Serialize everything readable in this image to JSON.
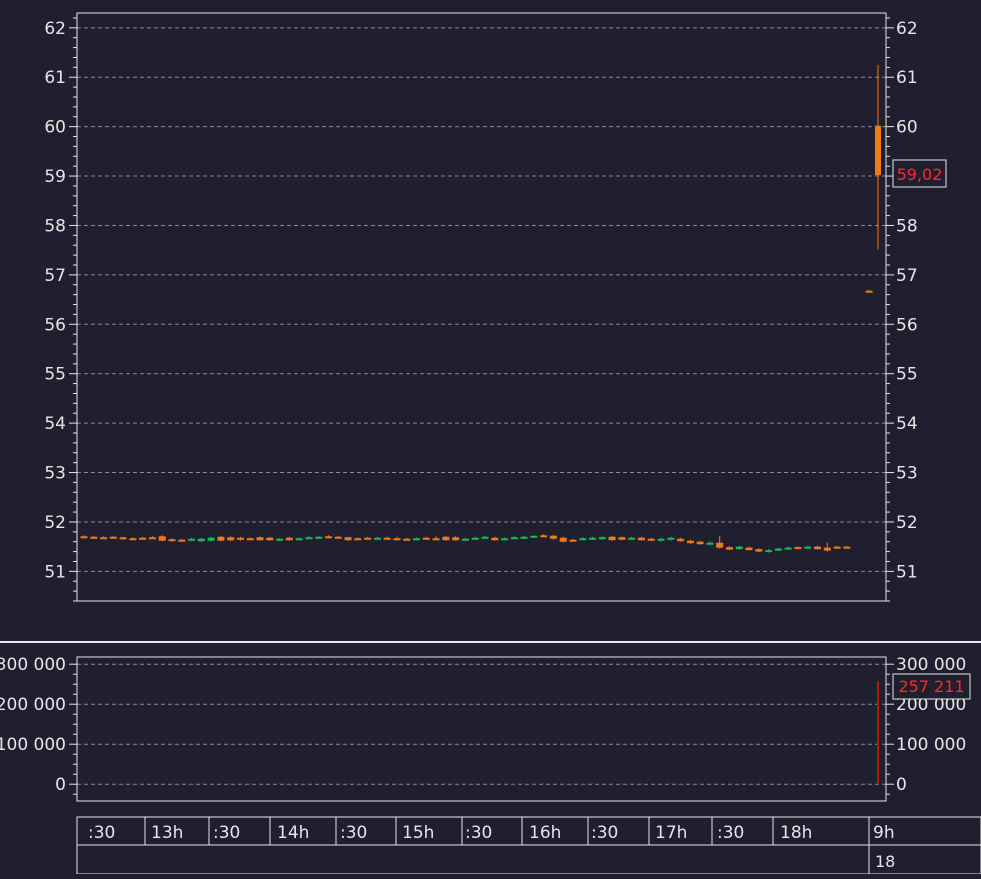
{
  "theme": {
    "background": "#1f1f2f",
    "frame": "#e6e6e6",
    "grid": "#8a8a9a",
    "text": "#e6e6e6",
    "up": "#1db954",
    "down": "#f07a1a",
    "last_price": "#ff2a2a",
    "volume": "#b01818"
  },
  "chart_data": [
    {
      "type": "candlestick",
      "name": "price",
      "ylim": [
        50.4,
        62.3
      ],
      "yticks": [
        51,
        52,
        53,
        54,
        55,
        56,
        57,
        58,
        59,
        60,
        61,
        62
      ],
      "y_tick_labels": [
        "51",
        "52",
        "53",
        "54",
        "55",
        "56",
        "57",
        "58",
        "59",
        "60",
        "61",
        "62"
      ],
      "grid": "horizontal dashed",
      "last_value_label": "59,02",
      "candles": [
        {
          "o": 51.71,
          "h": 51.73,
          "l": 51.67,
          "c": 51.68
        },
        {
          "o": 51.7,
          "h": 51.72,
          "l": 51.66,
          "c": 51.67
        },
        {
          "o": 51.69,
          "h": 51.71,
          "l": 51.66,
          "c": 51.68
        },
        {
          "o": 51.7,
          "h": 51.72,
          "l": 51.67,
          "c": 51.68
        },
        {
          "o": 51.69,
          "h": 51.7,
          "l": 51.64,
          "c": 51.65
        },
        {
          "o": 51.67,
          "h": 51.69,
          "l": 51.65,
          "c": 51.66
        },
        {
          "o": 51.68,
          "h": 51.7,
          "l": 51.66,
          "c": 51.67
        },
        {
          "o": 51.69,
          "h": 51.71,
          "l": 51.66,
          "c": 51.68
        },
        {
          "o": 51.71,
          "h": 51.73,
          "l": 51.61,
          "c": 51.62
        },
        {
          "o": 51.65,
          "h": 51.67,
          "l": 51.61,
          "c": 51.63
        },
        {
          "o": 51.64,
          "h": 51.66,
          "l": 51.61,
          "c": 51.63
        },
        {
          "o": 51.63,
          "h": 51.68,
          "l": 51.61,
          "c": 51.66
        },
        {
          "o": 51.61,
          "h": 51.68,
          "l": 51.59,
          "c": 51.66
        },
        {
          "o": 51.62,
          "h": 51.7,
          "l": 51.6,
          "c": 51.68
        },
        {
          "o": 51.7,
          "h": 51.72,
          "l": 51.61,
          "c": 51.62
        },
        {
          "o": 51.69,
          "h": 51.71,
          "l": 51.61,
          "c": 51.63
        },
        {
          "o": 51.68,
          "h": 51.7,
          "l": 51.62,
          "c": 51.64
        },
        {
          "o": 51.67,
          "h": 51.69,
          "l": 51.64,
          "c": 51.65
        },
        {
          "o": 51.69,
          "h": 51.71,
          "l": 51.62,
          "c": 51.63
        },
        {
          "o": 51.68,
          "h": 51.7,
          "l": 51.62,
          "c": 51.63
        },
        {
          "o": 51.64,
          "h": 51.68,
          "l": 51.62,
          "c": 51.66
        },
        {
          "o": 51.68,
          "h": 51.7,
          "l": 51.62,
          "c": 51.63
        },
        {
          "o": 51.65,
          "h": 51.69,
          "l": 51.63,
          "c": 51.67
        },
        {
          "o": 51.67,
          "h": 51.71,
          "l": 51.66,
          "c": 51.69
        },
        {
          "o": 51.68,
          "h": 51.72,
          "l": 51.67,
          "c": 51.7
        },
        {
          "o": 51.71,
          "h": 51.73,
          "l": 51.68,
          "c": 51.69
        },
        {
          "o": 51.7,
          "h": 51.72,
          "l": 51.67,
          "c": 51.68
        },
        {
          "o": 51.69,
          "h": 51.7,
          "l": 51.62,
          "c": 51.63
        },
        {
          "o": 51.67,
          "h": 51.69,
          "l": 51.64,
          "c": 51.65
        },
        {
          "o": 51.68,
          "h": 51.7,
          "l": 51.64,
          "c": 51.65
        },
        {
          "o": 51.66,
          "h": 51.7,
          "l": 51.64,
          "c": 51.68
        },
        {
          "o": 51.68,
          "h": 51.7,
          "l": 51.64,
          "c": 51.65
        },
        {
          "o": 51.67,
          "h": 51.7,
          "l": 51.63,
          "c": 51.64
        },
        {
          "o": 51.66,
          "h": 51.68,
          "l": 51.63,
          "c": 51.65
        },
        {
          "o": 51.65,
          "h": 51.69,
          "l": 51.63,
          "c": 51.67
        },
        {
          "o": 51.68,
          "h": 51.7,
          "l": 51.64,
          "c": 51.65
        },
        {
          "o": 51.67,
          "h": 51.71,
          "l": 51.64,
          "c": 51.66
        },
        {
          "o": 51.7,
          "h": 51.72,
          "l": 51.62,
          "c": 51.63
        },
        {
          "o": 51.69,
          "h": 51.71,
          "l": 51.62,
          "c": 51.63
        },
        {
          "o": 51.64,
          "h": 51.68,
          "l": 51.62,
          "c": 51.66
        },
        {
          "o": 51.66,
          "h": 51.7,
          "l": 51.64,
          "c": 51.68
        },
        {
          "o": 51.68,
          "h": 51.72,
          "l": 51.66,
          "c": 51.7
        },
        {
          "o": 51.68,
          "h": 51.7,
          "l": 51.62,
          "c": 51.63
        },
        {
          "o": 51.65,
          "h": 51.69,
          "l": 51.63,
          "c": 51.67
        },
        {
          "o": 51.67,
          "h": 51.71,
          "l": 51.65,
          "c": 51.69
        },
        {
          "o": 51.68,
          "h": 51.72,
          "l": 51.66,
          "c": 51.7
        },
        {
          "o": 51.71,
          "h": 51.73,
          "l": 51.69,
          "c": 51.72
        },
        {
          "o": 51.73,
          "h": 51.75,
          "l": 51.69,
          "c": 51.71
        },
        {
          "o": 51.72,
          "h": 51.74,
          "l": 51.64,
          "c": 51.66
        },
        {
          "o": 51.68,
          "h": 51.7,
          "l": 51.58,
          "c": 51.6
        },
        {
          "o": 51.64,
          "h": 51.66,
          "l": 51.62,
          "c": 51.63
        },
        {
          "o": 51.65,
          "h": 51.69,
          "l": 51.63,
          "c": 51.67
        },
        {
          "o": 51.66,
          "h": 51.7,
          "l": 51.64,
          "c": 51.68
        },
        {
          "o": 51.67,
          "h": 51.71,
          "l": 51.64,
          "c": 51.69
        },
        {
          "o": 51.7,
          "h": 51.72,
          "l": 51.62,
          "c": 51.63
        },
        {
          "o": 51.69,
          "h": 51.71,
          "l": 51.63,
          "c": 51.64
        },
        {
          "o": 51.66,
          "h": 51.7,
          "l": 51.64,
          "c": 51.68
        },
        {
          "o": 51.68,
          "h": 51.7,
          "l": 51.62,
          "c": 51.63
        },
        {
          "o": 51.66,
          "h": 51.68,
          "l": 51.61,
          "c": 51.62
        },
        {
          "o": 51.62,
          "h": 51.68,
          "l": 51.6,
          "c": 51.66
        },
        {
          "o": 51.64,
          "h": 51.7,
          "l": 51.62,
          "c": 51.68
        },
        {
          "o": 51.66,
          "h": 51.68,
          "l": 51.6,
          "c": 51.61
        },
        {
          "o": 51.62,
          "h": 51.64,
          "l": 51.56,
          "c": 51.57
        },
        {
          "o": 51.6,
          "h": 51.62,
          "l": 51.54,
          "c": 51.55
        },
        {
          "o": 51.55,
          "h": 51.61,
          "l": 51.53,
          "c": 51.58
        },
        {
          "o": 51.58,
          "h": 51.72,
          "l": 51.46,
          "c": 51.48
        },
        {
          "o": 51.49,
          "h": 51.51,
          "l": 51.43,
          "c": 51.44
        },
        {
          "o": 51.45,
          "h": 51.52,
          "l": 51.44,
          "c": 51.5
        },
        {
          "o": 51.48,
          "h": 51.5,
          "l": 51.42,
          "c": 51.43
        },
        {
          "o": 51.45,
          "h": 51.47,
          "l": 51.39,
          "c": 51.4
        },
        {
          "o": 51.4,
          "h": 51.45,
          "l": 51.38,
          "c": 51.43
        },
        {
          "o": 51.43,
          "h": 51.48,
          "l": 51.41,
          "c": 51.46
        },
        {
          "o": 51.46,
          "h": 51.5,
          "l": 51.44,
          "c": 51.48
        },
        {
          "o": 51.49,
          "h": 51.51,
          "l": 51.46,
          "c": 51.47
        },
        {
          "o": 51.48,
          "h": 51.52,
          "l": 51.46,
          "c": 51.5
        },
        {
          "o": 51.5,
          "h": 51.52,
          "l": 51.44,
          "c": 51.45
        },
        {
          "o": 51.48,
          "h": 51.58,
          "l": 51.4,
          "c": 51.42
        },
        {
          "o": 51.5,
          "h": 51.52,
          "l": 51.47,
          "c": 51.48
        },
        {
          "o": 51.5,
          "h": 51.51,
          "l": 51.48,
          "c": 51.49
        },
        {
          "o": 56.68,
          "h": 56.7,
          "l": 56.64,
          "c": 56.66
        },
        {
          "o": 60.02,
          "h": 61.25,
          "l": 57.52,
          "c": 59.02
        }
      ]
    },
    {
      "type": "bar",
      "name": "volume",
      "ylim": [
        -42000,
        318000
      ],
      "yticks": [
        0,
        100000,
        200000,
        300000
      ],
      "y_tick_labels": [
        "0",
        "100 000",
        "200 000",
        "300 000"
      ],
      "grid": "horizontal dashed",
      "last_value_label": "257 211",
      "values": [
        180,
        150,
        120,
        160,
        210,
        140,
        110,
        130,
        250,
        170,
        140,
        160,
        190,
        150,
        120,
        130,
        140,
        110,
        170,
        150,
        180,
        160,
        130,
        150,
        140,
        170,
        200,
        150,
        120,
        140,
        180,
        160,
        150,
        130,
        120,
        170,
        190,
        140,
        160,
        130,
        150,
        180,
        210,
        170,
        140,
        160,
        190,
        230,
        210,
        250,
        170,
        190,
        150,
        160,
        180,
        140,
        170,
        200,
        160,
        190,
        320,
        410,
        260,
        380,
        1500,
        2400,
        1800,
        900,
        1300,
        3800,
        700,
        2100,
        1100,
        900,
        700,
        1200,
        1500,
        800,
        1600,
        2400,
        900,
        3100,
        257211
      ]
    }
  ],
  "time_axis": {
    "labels": [
      ":30",
      "13h",
      ":30",
      "14h",
      ":30",
      "15h",
      ":30",
      "16h",
      ":30",
      "17h",
      ":30",
      "18h",
      "9h"
    ],
    "date_label": "18"
  }
}
